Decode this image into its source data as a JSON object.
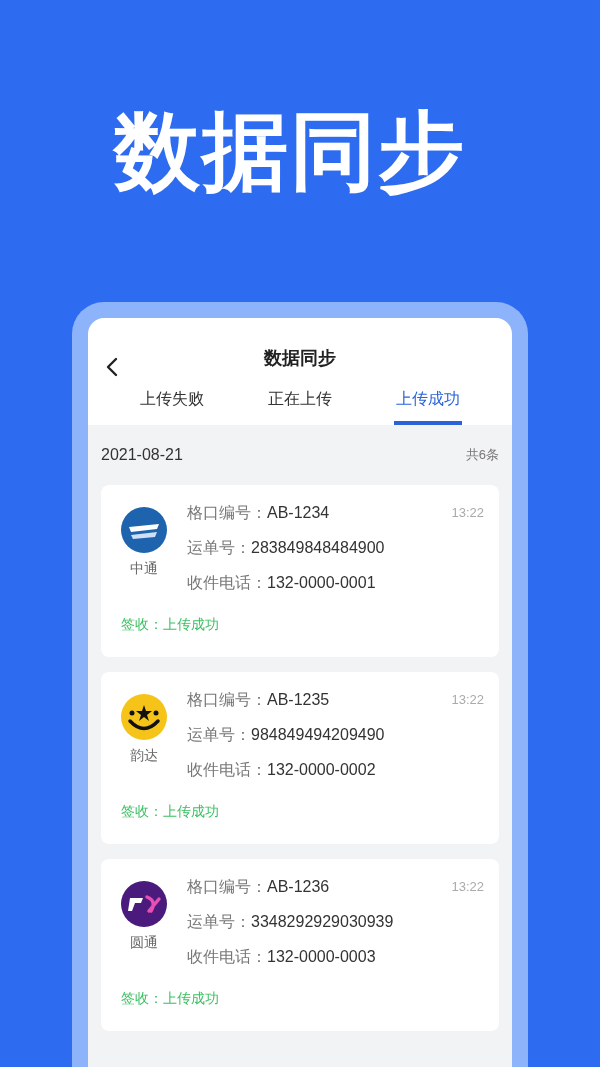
{
  "headline": "数据同步",
  "screen": {
    "title": "数据同步",
    "tabs": [
      {
        "label": "上传失败",
        "selected": false
      },
      {
        "label": "正在上传",
        "selected": false
      },
      {
        "label": "上传成功",
        "selected": true
      }
    ],
    "date": "2021-08-21",
    "count": "共6条",
    "records": [
      {
        "carrier": "中通",
        "logo": {
          "kind": "zto"
        },
        "time": "13:22",
        "fields": [
          {
            "label": "格口编号：",
            "value": "AB-1234"
          },
          {
            "label": "运单号：",
            "value": "283849848484900"
          },
          {
            "label": "收件电话：",
            "value": "132-0000-0001"
          }
        ],
        "status_label": "签收：",
        "status": "上传成功"
      },
      {
        "carrier": "韵达",
        "logo": {
          "kind": "yunda"
        },
        "time": "13:22",
        "fields": [
          {
            "label": "格口编号：",
            "value": "AB-1235"
          },
          {
            "label": "运单号：",
            "value": "984849494209490"
          },
          {
            "label": "收件电话：",
            "value": "132-0000-0002"
          }
        ],
        "status_label": "签收：",
        "status": "上传成功"
      },
      {
        "carrier": "圆通",
        "logo": {
          "kind": "yto"
        },
        "time": "13:22",
        "fields": [
          {
            "label": "格口编号：",
            "value": "AB-1236"
          },
          {
            "label": "运单号：",
            "value": "3348292929030939"
          },
          {
            "label": "收件电话：",
            "value": "132-0000-0003"
          }
        ],
        "status_label": "签收：",
        "status": "上传成功"
      }
    ]
  }
}
